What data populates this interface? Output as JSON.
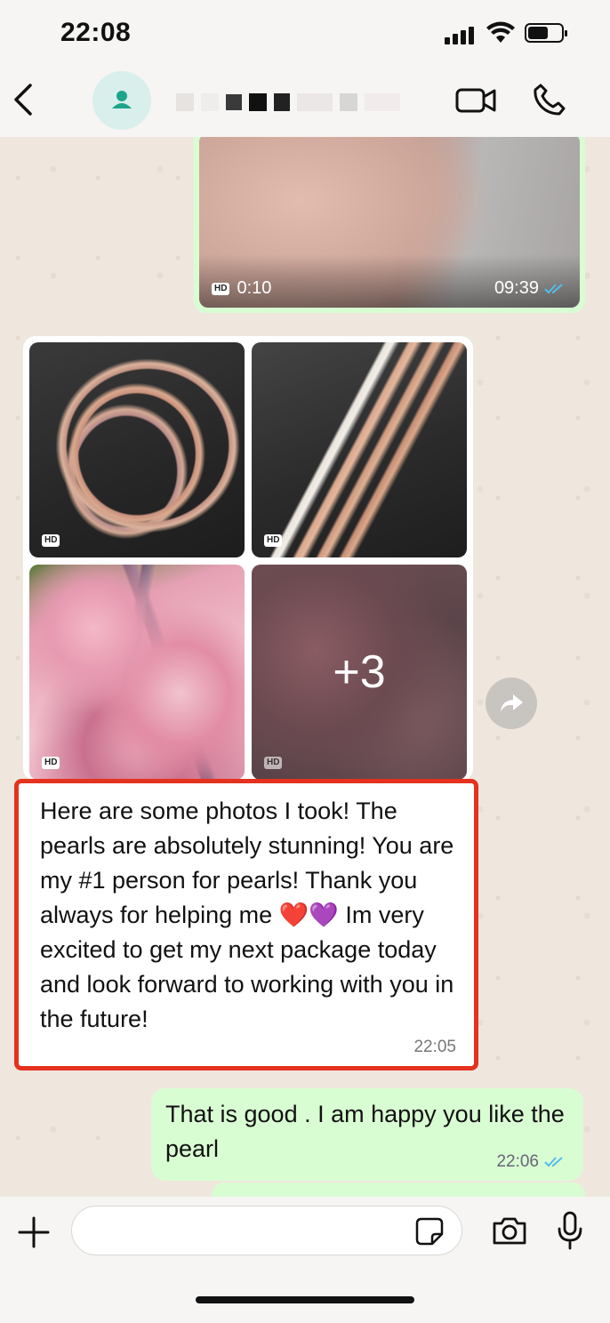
{
  "status_bar": {
    "time": "22:08"
  },
  "header": {
    "contact_name": ""
  },
  "messages": {
    "video": {
      "badge": "HD",
      "duration": "0:10",
      "time": "09:39"
    },
    "album": {
      "badge": "HD",
      "more_count": "+3"
    },
    "incoming_text": {
      "text": "Here are some photos I took! The pearls are absolutely stunning! You are my #1 person for pearls! Thank you always for helping me ❤️💜 Im very excited to get my next package today and look forward to working with you in the future!",
      "time": "22:05"
    },
    "outgoing_text": {
      "text": "That is good . I am happy you like the pearl",
      "time": "22:06"
    }
  },
  "input": {
    "placeholder": ""
  },
  "colors": {
    "outgoing_bubble": "#d9fdd3",
    "highlight": "#e4321e",
    "read_tick": "#53bdeb",
    "avatar_icon": "#1da58a"
  },
  "icons": [
    "back-icon",
    "contact-avatar-icon",
    "video-call-icon",
    "phone-icon",
    "forward-icon",
    "plus-icon",
    "sticker-icon",
    "camera-icon",
    "mic-icon",
    "double-check-icon"
  ]
}
